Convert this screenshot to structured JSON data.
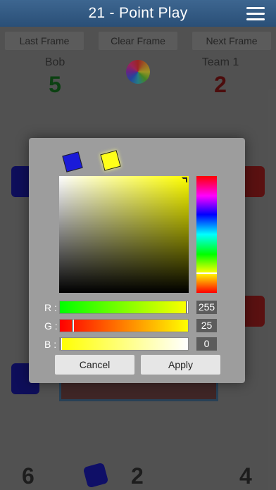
{
  "header": {
    "title": "21 - Point Play",
    "menu_icon": "hamburger-menu-icon"
  },
  "toolbar": {
    "last_frame": "Last Frame",
    "clear_frame": "Clear Frame",
    "next_frame": "Next Frame"
  },
  "players": {
    "left": {
      "name": "Bob",
      "score": "5",
      "color": "#0f4d16"
    },
    "right": {
      "name": "Team 1",
      "score": "2",
      "color": "#5a0f0f"
    }
  },
  "bottom_scores": {
    "left": "6",
    "center": "2",
    "right": "4"
  },
  "color_picker": {
    "previous_color": "#1a1ad8",
    "current_color": "#ffff19",
    "channels": [
      {
        "label": "R :",
        "value": "255"
      },
      {
        "label": "G :",
        "value": "25"
      },
      {
        "label": "B :",
        "value": "0"
      }
    ],
    "cancel_label": "Cancel",
    "apply_label": "Apply"
  }
}
